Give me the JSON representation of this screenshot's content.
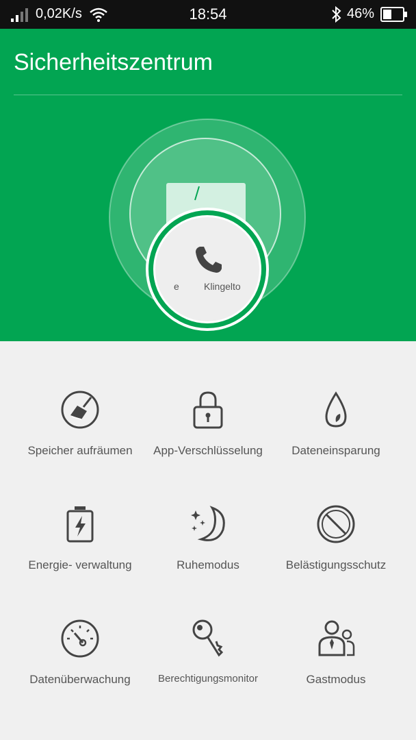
{
  "status_bar": {
    "network_speed": "0,02K/s",
    "time": "18:54",
    "battery_percent": "46%",
    "battery_level": 0.46
  },
  "header": {
    "title": "Sicherheitszentrum",
    "orb": {
      "left_label": "e",
      "right_label": "Klingelto"
    },
    "background_color": "#02a552"
  },
  "features": [
    {
      "label": "Speicher aufräumen",
      "icon": "broom-icon"
    },
    {
      "label": "App-Verschlüsselung",
      "icon": "lock-icon"
    },
    {
      "label": "Dateneinsparung",
      "icon": "drop-icon"
    },
    {
      "label": "Energie- verwaltung",
      "icon": "battery-bolt-icon"
    },
    {
      "label": "Ruhemodus",
      "icon": "moon-icon"
    },
    {
      "label": "Belästigungsschutz",
      "icon": "block-icon"
    },
    {
      "label": "Datenüberwachung",
      "icon": "gauge-icon"
    },
    {
      "label": "Berechtigungsmonitor",
      "icon": "key-icon"
    },
    {
      "label": "Gastmodus",
      "icon": "guest-icon"
    }
  ]
}
